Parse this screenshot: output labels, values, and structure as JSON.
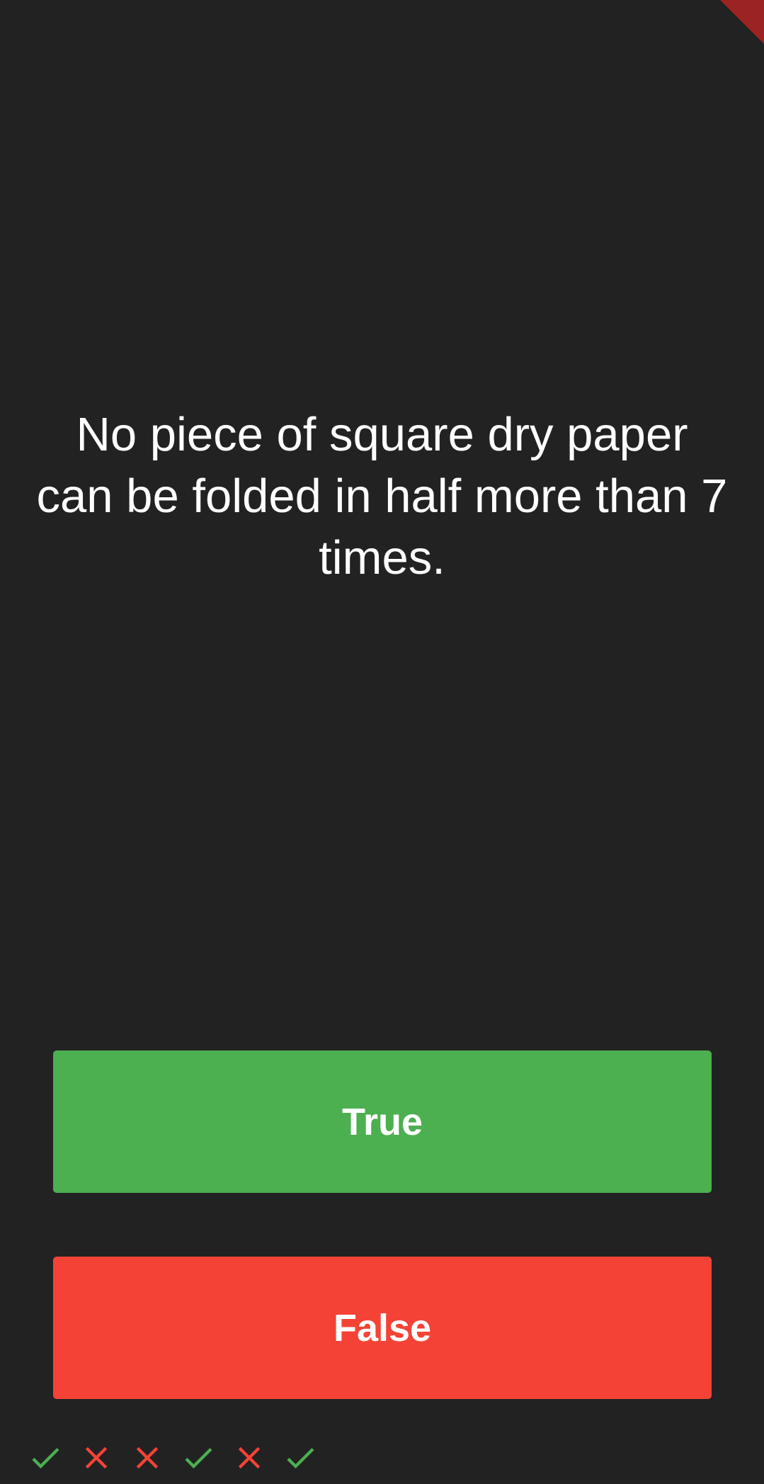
{
  "question": {
    "text": "No piece of square dry paper can be folded in half more than 7 times."
  },
  "buttons": {
    "true_label": "True",
    "false_label": "False"
  },
  "colors": {
    "background": "#222222",
    "true": "#4caf50",
    "false": "#f44336",
    "correct_mark": "#4caf50",
    "wrong_mark": "#f44336",
    "debug_ribbon": "#9b2323"
  },
  "score_keeper": [
    {
      "result": "correct",
      "icon": "check-icon"
    },
    {
      "result": "wrong",
      "icon": "close-icon"
    },
    {
      "result": "wrong",
      "icon": "close-icon"
    },
    {
      "result": "correct",
      "icon": "check-icon"
    },
    {
      "result": "wrong",
      "icon": "close-icon"
    },
    {
      "result": "correct",
      "icon": "check-icon"
    }
  ]
}
